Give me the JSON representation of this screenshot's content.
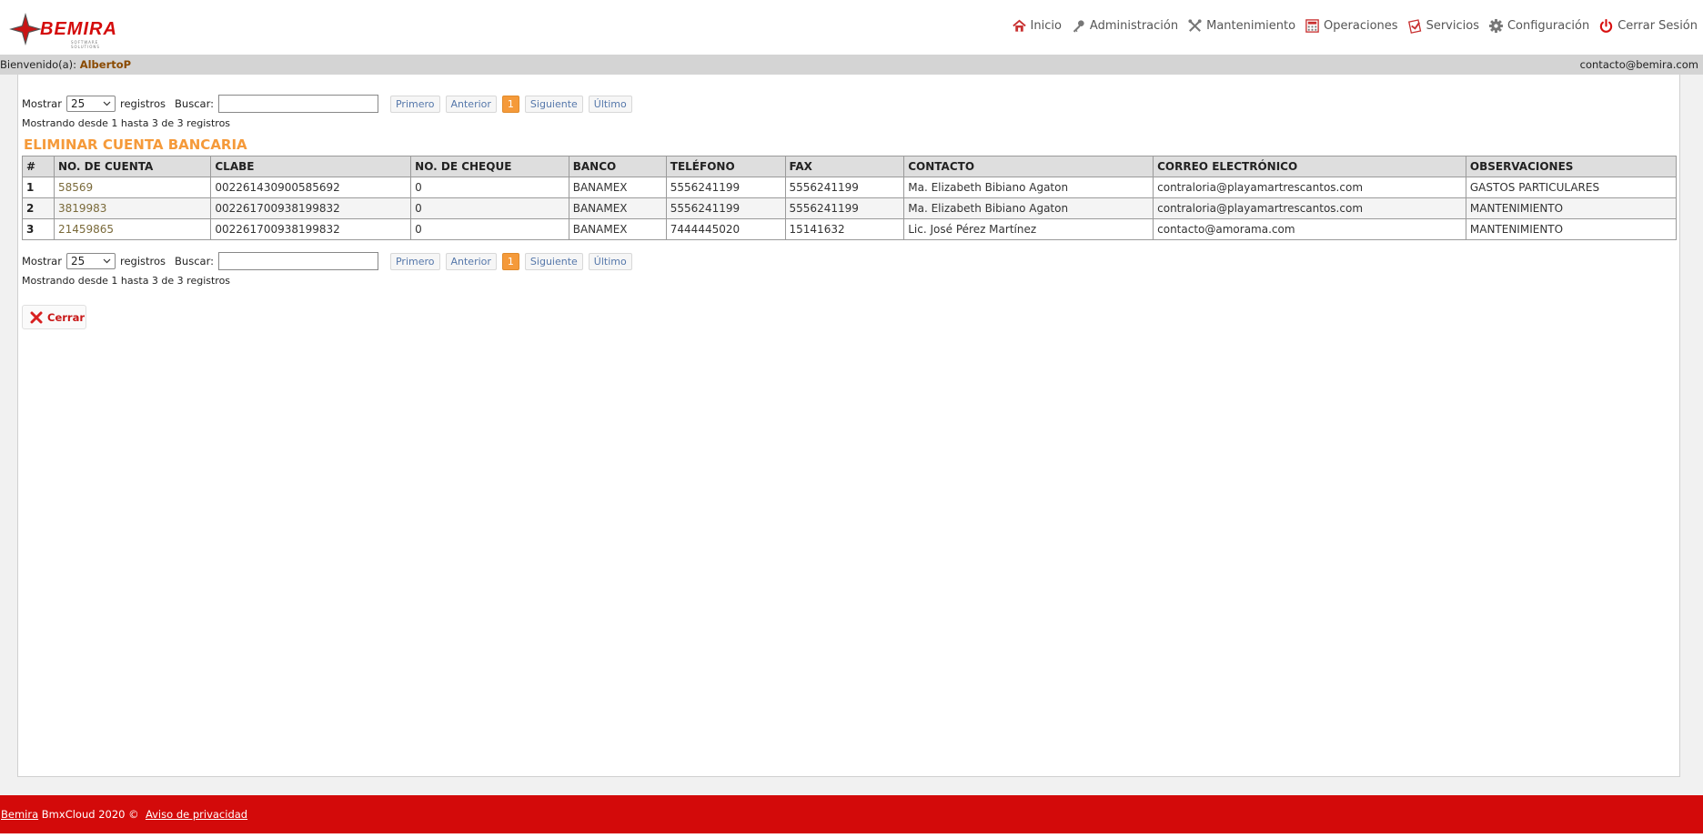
{
  "brand": {
    "name": "BEMIRA",
    "tagline": "SOFTWARE SOLUTIONS",
    "accent": "#d30a0a"
  },
  "nav": [
    {
      "label": "Inicio",
      "icon": "home-icon"
    },
    {
      "label": "Administración",
      "icon": "key-icon"
    },
    {
      "label": "Mantenimiento",
      "icon": "tools-icon"
    },
    {
      "label": "Operaciones",
      "icon": "calculator-icon"
    },
    {
      "label": "Servicios",
      "icon": "services-icon"
    },
    {
      "label": "Configuración",
      "icon": "gear-icon"
    },
    {
      "label": "Cerrar Sesión",
      "icon": "power-icon"
    }
  ],
  "welcome": {
    "prefix": "Bienvenido(a):",
    "user": "AlbertoP",
    "email": "contacto@bemira.com"
  },
  "controls": {
    "show_label": "Mostrar",
    "show_value": "25",
    "records_label": "registros",
    "search_label": "Buscar:",
    "search_value": "",
    "pager": {
      "first": "Primero",
      "prev": "Anterior",
      "current": "1",
      "next": "Siguiente",
      "last": "Último"
    },
    "showing_text": "Mostrando desde 1 hasta 3 de 3 registros"
  },
  "section_title": "ELIMINAR CUENTA BANCARIA",
  "table": {
    "headers": [
      "#",
      "NO. DE CUENTA",
      "CLABE",
      "NO. DE CHEQUE",
      "BANCO",
      "TELÉFONO",
      "FAX",
      "CONTACTO",
      "CORREO ELECTRÓNICO",
      "OBSERVACIONES"
    ],
    "rows": [
      [
        "1",
        "58569",
        "002261430900585692",
        "0",
        "BANAMEX",
        "5556241199",
        "5556241199",
        "Ma. Elizabeth Bibiano Agaton",
        "contraloria@playamartrescantos.com",
        "GASTOS PARTICULARES"
      ],
      [
        "2",
        "3819983",
        "002261700938199832",
        "0",
        "BANAMEX",
        "5556241199",
        "5556241199",
        "Ma. Elizabeth Bibiano Agaton",
        "contraloria@playamartrescantos.com",
        "MANTENIMIENTO"
      ],
      [
        "3",
        "21459865",
        "002261700938199832",
        "0",
        "BANAMEX",
        "7444445020",
        "15141632",
        "Lic. José Pérez Martínez",
        "contacto@amorama.com",
        "MANTENIMIENTO"
      ]
    ]
  },
  "close_button": "Cerrar",
  "footer": {
    "brand_link": "Bemira",
    "text": " BmxCloud 2020 ©  ",
    "privacy_link": "Aviso de privacidad"
  }
}
